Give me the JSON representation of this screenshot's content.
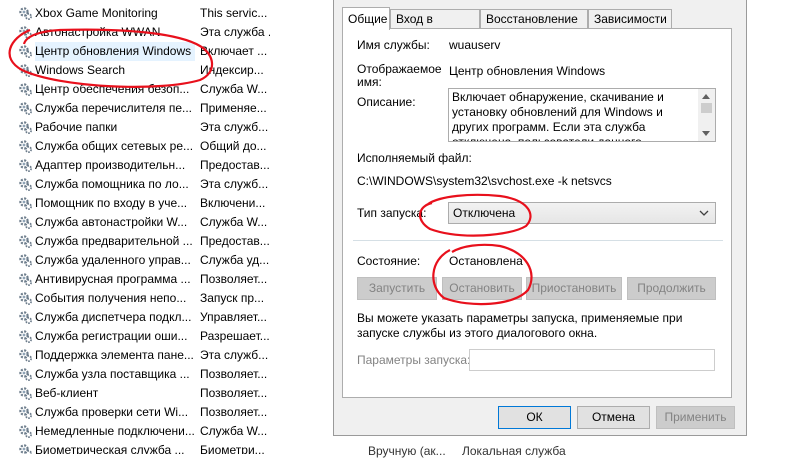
{
  "services": [
    {
      "name": "Xbox Game Monitoring",
      "desc": "This servic..."
    },
    {
      "name": "Автонастройка WWAN",
      "desc": "Эта служба ..."
    },
    {
      "name": "Центр обновления Windows",
      "desc": "Включает ..."
    },
    {
      "name": "Windows Search",
      "desc": "Индексир..."
    },
    {
      "name": "Центр обеспечения безоп...",
      "desc": "Служба W..."
    },
    {
      "name": "Служба перечислителя пе...",
      "desc": "Применяе..."
    },
    {
      "name": "Рабочие папки",
      "desc": "Эта служб..."
    },
    {
      "name": "Служба общих сетевых ре...",
      "desc": "Общий до..."
    },
    {
      "name": "Адаптер производительн...",
      "desc": "Предостав..."
    },
    {
      "name": "Служба помощника по ло...",
      "desc": "Эта служб..."
    },
    {
      "name": "Помощник по входу в уче...",
      "desc": "Включени..."
    },
    {
      "name": "Служба автонастройки W...",
      "desc": "Служба W..."
    },
    {
      "name": "Служба предварительной ...",
      "desc": "Предостав..."
    },
    {
      "name": "Служба удаленного управ...",
      "desc": "Служба уд..."
    },
    {
      "name": "Антивирусная программа ...",
      "desc": "Позволяет..."
    },
    {
      "name": "События получения непо...",
      "desc": "Запуск пр..."
    },
    {
      "name": "Служба диспетчера подкл...",
      "desc": "Управляет..."
    },
    {
      "name": "Служба регистрации оши...",
      "desc": "Разрешает..."
    },
    {
      "name": "Поддержка элемента пане...",
      "desc": "Эта служб..."
    },
    {
      "name": "Служба узла поставщика ...",
      "desc": "Позволяет..."
    },
    {
      "name": "Веб-клиент",
      "desc": "Позволяет..."
    },
    {
      "name": "Служба проверки сети Wi...",
      "desc": "Позволяет..."
    },
    {
      "name": "Немедленные подключени...",
      "desc": "Служба W..."
    },
    {
      "name": "Биометрическая служба ...",
      "desc": "Биометри..."
    }
  ],
  "bottom_extra": {
    "startup": "Вручную (ак...",
    "logon": "Локальная служба"
  },
  "dialog": {
    "tabs": [
      "Общие",
      "Вход в систему",
      "Восстановление",
      "Зависимости"
    ],
    "service_name_label": "Имя службы:",
    "service_name_value": "wuauserv",
    "display_name_label_1": "Отображаемое",
    "display_name_label_2": "имя:",
    "display_name_value": "Центр обновления Windows",
    "description_label": "Описание:",
    "description_text": "Включает обнаружение, скачивание и установку обновлений для Windows и других программ. Если эта служба отключена, пользователи данного компьютера не смогут использовать",
    "exe_label": "Исполняемый файл:",
    "exe_value": "C:\\WINDOWS\\system32\\svchost.exe -k netsvcs",
    "startup_type_label": "Тип запуска:",
    "startup_type_value": "Отключена",
    "status_label": "Состояние:",
    "status_value": "Остановлена",
    "buttons": {
      "start": "Запустить",
      "stop": "Остановить",
      "pause": "Приостановить",
      "resume": "Продолжить"
    },
    "hint_text": "Вы можете указать параметры запуска, применяемые при запуске службы из этого диалогового окна.",
    "params_label": "Параметры запуска:",
    "params_value": "",
    "ok": "ОК",
    "cancel": "Отмена",
    "apply": "Применить"
  },
  "colors": {
    "accent": "#0078d7",
    "annotation": "#e8101c",
    "selected_row": "#e5f3ff"
  }
}
